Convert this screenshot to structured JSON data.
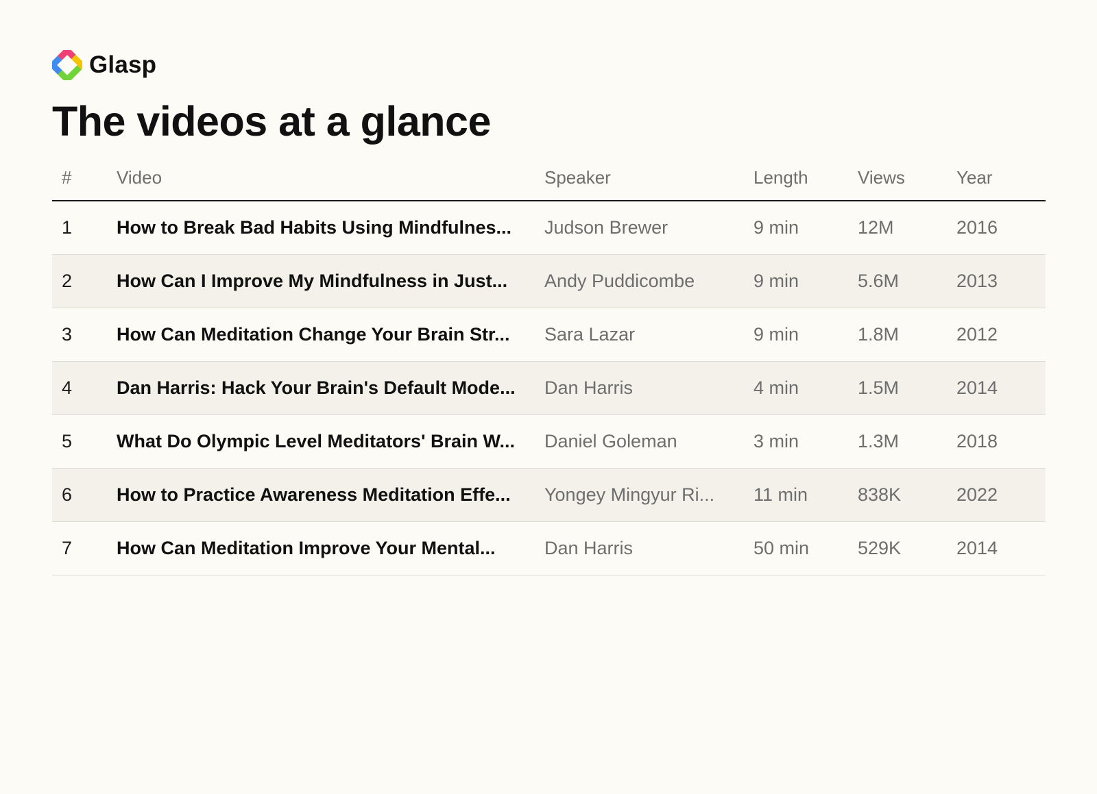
{
  "brand": {
    "name": "Glasp",
    "logo_icon": "glasp-logo-icon",
    "logo_colors": [
      "#f5c400",
      "#6fd43a",
      "#3f8cf0",
      "#ef3f78"
    ]
  },
  "title": "The videos at a glance",
  "table": {
    "columns": [
      "#",
      "Video",
      "Speaker",
      "Length",
      "Views",
      "Year"
    ],
    "rows": [
      [
        "1",
        "How to Break Bad Habits Using Mindfulnes...",
        "Judson Brewer",
        "9 min",
        "12M",
        "2016"
      ],
      [
        "2",
        "How Can I Improve My Mindfulness in Just...",
        "Andy Puddicombe",
        "9 min",
        "5.6M",
        "2013"
      ],
      [
        "3",
        "How Can Meditation Change Your Brain Str...",
        "Sara Lazar",
        "9 min",
        "1.8M",
        "2012"
      ],
      [
        "4",
        "Dan Harris: Hack Your Brain's Default Mode...",
        "Dan Harris",
        "4 min",
        "1.5M",
        "2014"
      ],
      [
        "5",
        "What Do Olympic Level Meditators' Brain W...",
        "Daniel Goleman",
        "3 min",
        "1.3M",
        "2018"
      ],
      [
        "6",
        "How to Practice Awareness Meditation Effe...",
        "Yongey Mingyur Ri...",
        "11 min",
        "838K",
        "2022"
      ],
      [
        "7",
        "How Can Meditation Improve Your Mental...",
        "Dan Harris",
        "50 min",
        "529K",
        "2014"
      ]
    ]
  }
}
